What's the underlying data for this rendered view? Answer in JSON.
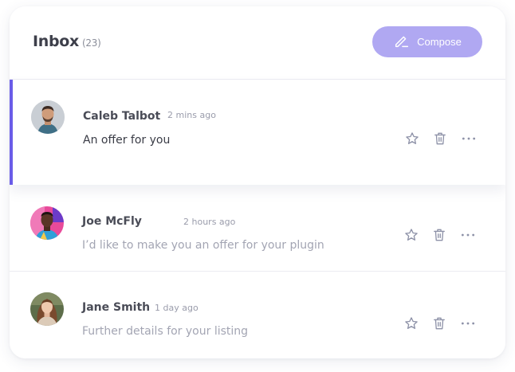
{
  "inbox": {
    "title": "Inbox",
    "count": "(23)",
    "compose_label": "Compose",
    "accent_color": "#6a5ce8",
    "compose_color": "#b0a8f2"
  },
  "messages": [
    {
      "sender": "Caleb Talbot",
      "time": "2 mins ago",
      "subject": "An offer for you",
      "unread": true,
      "selected": true
    },
    {
      "sender": "Joe McFly",
      "time": "2 hours ago",
      "subject": "I’d like to make you an offer for your plugin",
      "unread": false,
      "selected": false
    },
    {
      "sender": "Jane Smith",
      "time": "1 day ago",
      "subject": "Further details for your listing",
      "unread": false,
      "selected": false
    }
  ],
  "icons": {
    "compose": "pencil-icon",
    "star": "star-icon",
    "delete": "trash-icon",
    "more": "more-horizontal-icon"
  }
}
